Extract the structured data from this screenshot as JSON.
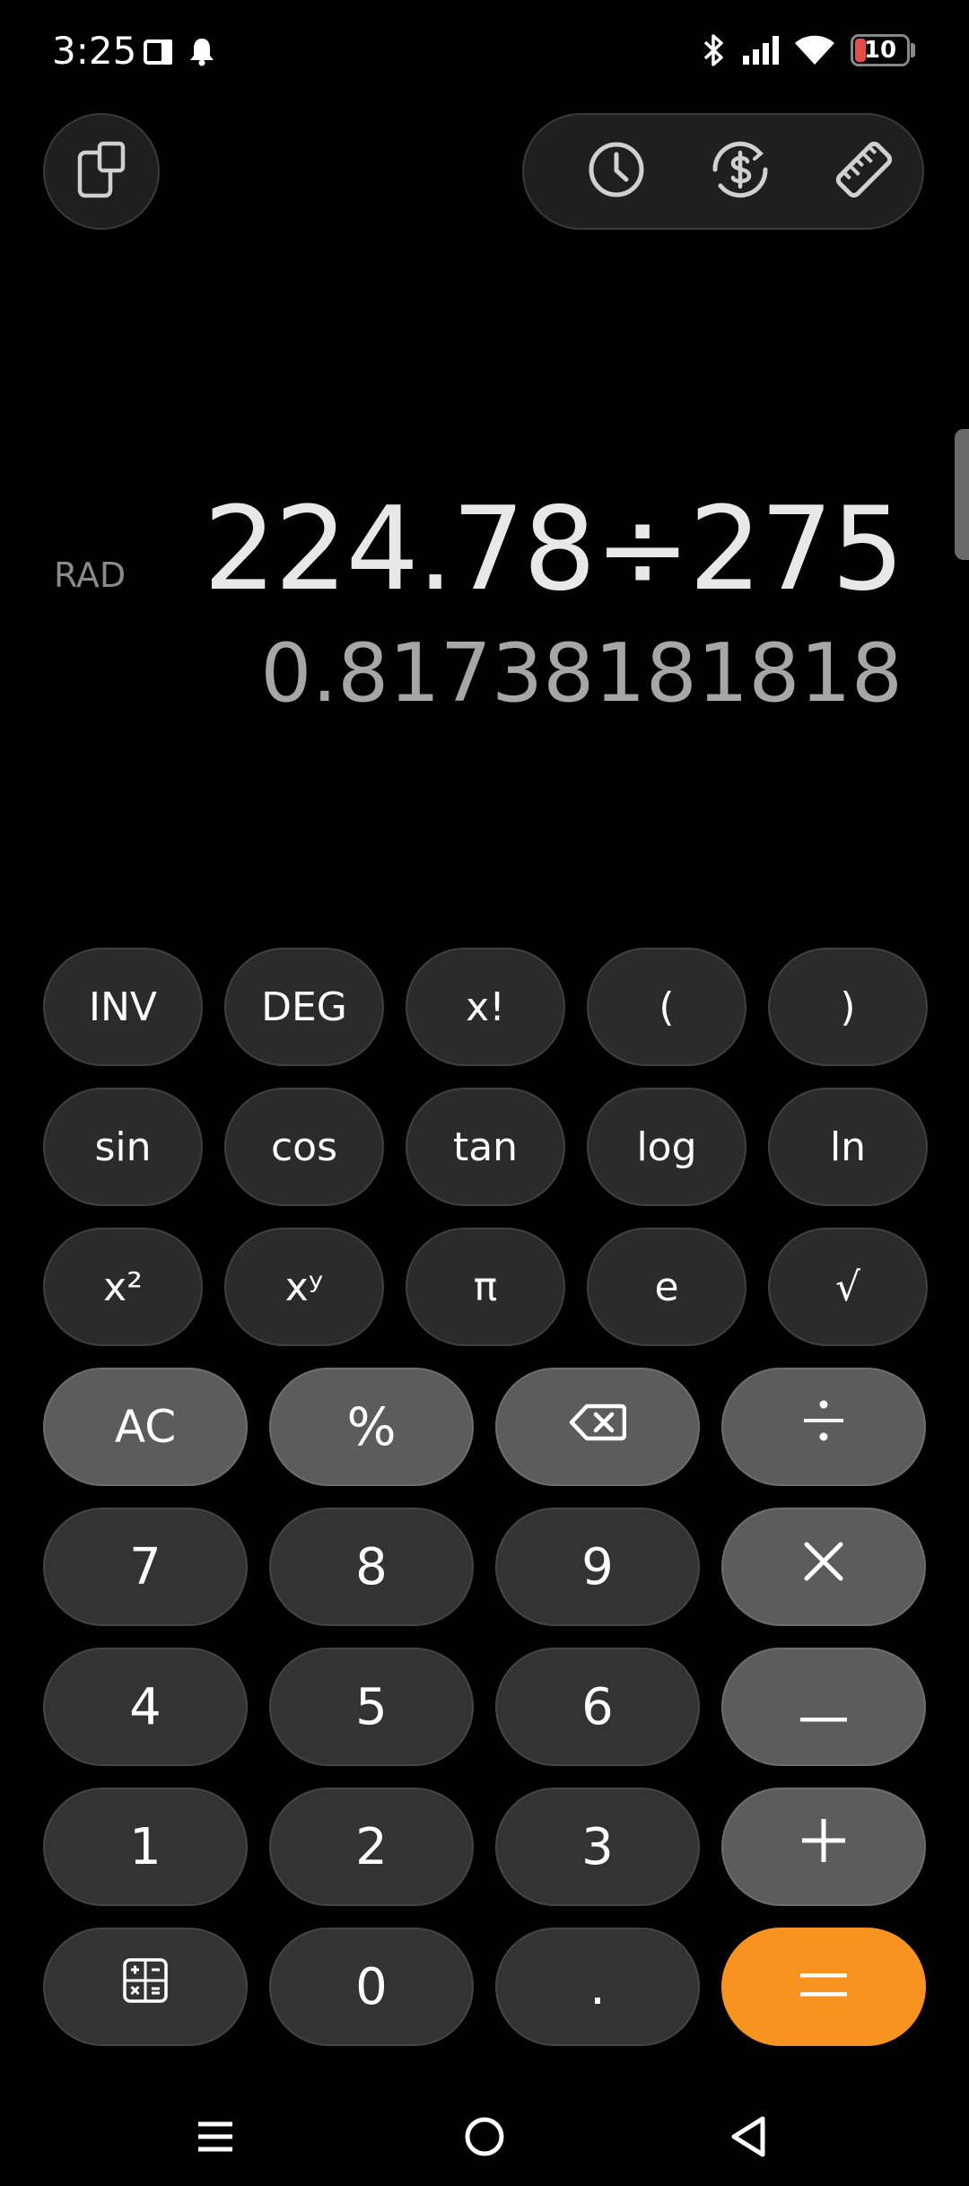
{
  "status_bar": {
    "time": "3:25",
    "battery_level": "10",
    "icons": [
      "notification-app-icon",
      "bell-icon",
      "bluetooth-icon",
      "signal-icon",
      "wifi-icon",
      "battery-icon"
    ]
  },
  "toolbar": {
    "mode_icon": "calculator-mode-icon",
    "tools": [
      "history-icon",
      "currency-icon",
      "ruler-icon"
    ]
  },
  "display": {
    "angle_mode": "RAD",
    "expression": "224.78÷275",
    "result": "0.81738181818"
  },
  "keypad": {
    "sci_row1": [
      "INV",
      "DEG",
      "x!",
      "(",
      ")"
    ],
    "sci_row2": [
      "sin",
      "cos",
      "tan",
      "log",
      "ln"
    ],
    "sci_row3": [
      "x²",
      "xʸ",
      "π",
      "e",
      "√"
    ],
    "clear": "AC",
    "percent": "%",
    "backspace_icon": "backspace-icon",
    "divide_icon": "divide-icon",
    "multiply_icon": "multiply-icon",
    "minus_icon": "minus-icon",
    "plus_icon": "plus-icon",
    "equals_icon": "equals-icon",
    "scientific_toggle_icon": "scientific-toggle-icon",
    "digits": {
      "seven": "7",
      "eight": "8",
      "nine": "9",
      "four": "4",
      "five": "5",
      "six": "6",
      "one": "1",
      "two": "2",
      "three": "3",
      "zero": "0",
      "decimal": "."
    }
  },
  "colors": {
    "background": "#000000",
    "accent": "#f7931e",
    "battery_low": "#e54b4b"
  },
  "nav_bar": {
    "icons": [
      "menu-icon",
      "home-icon",
      "back-icon"
    ]
  }
}
